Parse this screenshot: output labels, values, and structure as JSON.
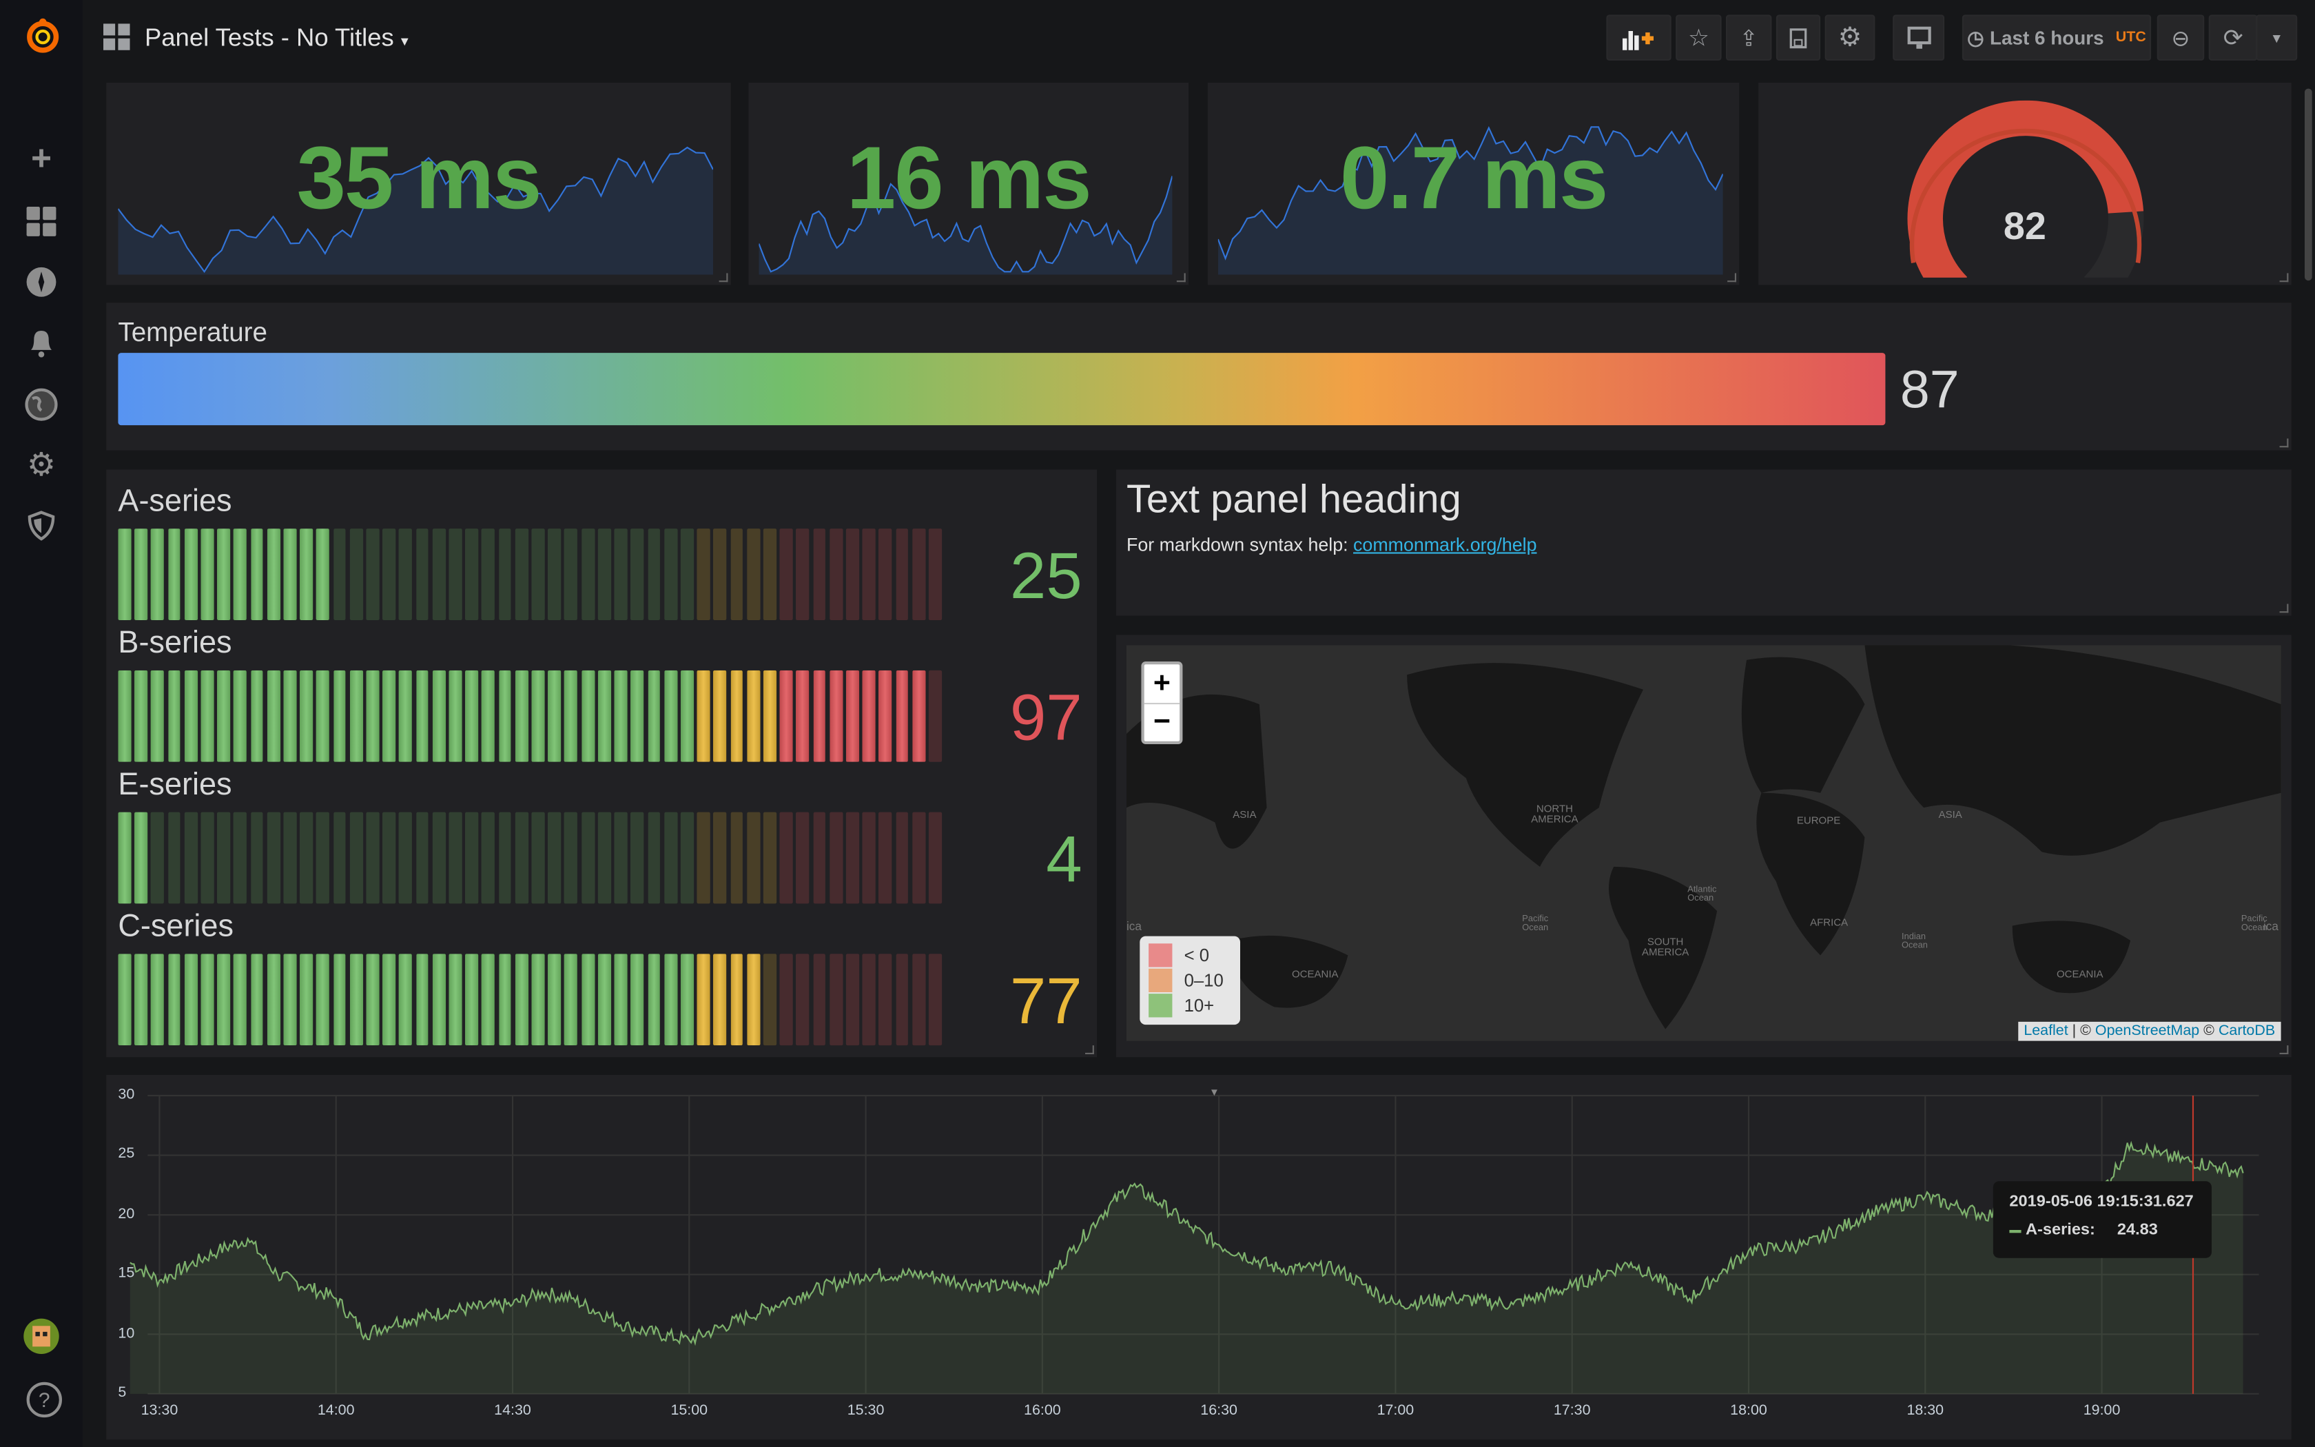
{
  "header": {
    "title": "Panel Tests - No Titles",
    "time_range": "Last 6 hours",
    "timezone": "UTC"
  },
  "icons": {
    "sidebar": [
      "grafana-logo-icon",
      "plus-icon",
      "dashboards-icon",
      "explore-compass-icon",
      "alerting-bell-icon",
      "globe-icon",
      "gear-icon",
      "shield-icon",
      "avatar",
      "help-icon"
    ],
    "toolbar": [
      "add-panel-icon",
      "star-icon",
      "share-icon",
      "save-icon",
      "settings-gear-icon",
      "tv-mode-icon",
      "clock-icon",
      "zoom-out-icon",
      "refresh-icon",
      "caret-down-icon"
    ]
  },
  "sidebar": {
    "help": "?"
  },
  "stats": [
    {
      "value": "35 ms"
    },
    {
      "value": "16 ms"
    },
    {
      "value": "0.7 ms"
    }
  ],
  "gauge": {
    "value": "82",
    "fraction": 0.82,
    "color": "#d44a3a"
  },
  "temperature": {
    "label": "Temperature",
    "value": "87",
    "color": "#e0555a"
  },
  "bar_gauges": [
    {
      "label": "A-series",
      "value": "25",
      "pct": 25,
      "color": "#73bf69"
    },
    {
      "label": "B-series",
      "value": "97",
      "pct": 97,
      "color": "#e0555a"
    },
    {
      "label": "E-series",
      "value": "4",
      "pct": 4,
      "color": "#73bf69"
    },
    {
      "label": "C-series",
      "value": "77",
      "pct": 77,
      "color": "#eab839"
    }
  ],
  "thresholds": {
    "green": "#73bf69",
    "yellow": "#eab839",
    "red": "#e0555a"
  },
  "text_panel": {
    "heading": "Text panel heading",
    "help_prefix": "For markdown syntax help: ",
    "link": "commonmark.org/help"
  },
  "map": {
    "zoom_in": "+",
    "zoom_out": "−",
    "legend": [
      {
        "label": "< 0",
        "color": "#e88a8a"
      },
      {
        "label": "0–10",
        "color": "#e8a87c"
      },
      {
        "label": "10+",
        "color": "#8ec27a"
      }
    ],
    "labels": [
      "Asia",
      "North America",
      "Europe",
      "Asia",
      "Africa",
      "South America",
      "Oceania",
      "Oceania",
      "Pacific Ocean",
      "Atlantic Ocean",
      "Indian Ocean",
      "Pacific Ocean",
      "ica",
      "ica"
    ],
    "attribution": {
      "leaflet": "Leaflet",
      "sep": " | © ",
      "osm": "OpenStreetMap",
      "sep2": " © ",
      "carto": "CartoDB"
    }
  },
  "chart_data": {
    "type": "area",
    "ylim": [
      5,
      30
    ],
    "yticks": [
      "30",
      "25",
      "20",
      "15",
      "10",
      "5"
    ],
    "xticks": [
      "13:30",
      "14:00",
      "14:30",
      "15:00",
      "15:30",
      "16:00",
      "16:30",
      "17:00",
      "17:30",
      "18:00",
      "18:30",
      "19:00"
    ],
    "grid": true,
    "series": [
      {
        "name": "A-series",
        "color": "#7eb26d",
        "x": [
          "13:25",
          "13:30",
          "13:40",
          "13:45",
          "13:50",
          "14:00",
          "14:05",
          "14:10",
          "14:20",
          "14:30",
          "14:35",
          "14:40",
          "14:50",
          "15:00",
          "15:10",
          "15:20",
          "15:30",
          "15:40",
          "15:50",
          "16:00",
          "16:05",
          "16:10",
          "16:15",
          "16:20",
          "16:25",
          "16:30",
          "16:40",
          "16:50",
          "17:00",
          "17:10",
          "17:20",
          "17:30",
          "17:40",
          "17:50",
          "17:55",
          "18:00",
          "18:10",
          "18:20",
          "18:30",
          "18:40",
          "18:50",
          "19:00",
          "19:05",
          "19:10",
          "19:20",
          "19:24"
        ],
        "values": [
          16,
          14.5,
          17,
          18,
          15,
          13,
          10,
          11,
          12,
          12.5,
          13.5,
          13,
          10.5,
          9.5,
          11.5,
          13.5,
          15,
          15,
          14,
          14,
          17,
          20,
          22.5,
          21,
          19,
          17.5,
          15.5,
          15.5,
          12.5,
          13,
          12.5,
          14,
          16,
          13,
          15,
          17,
          17.5,
          20,
          21.5,
          20,
          20.5,
          22,
          26,
          25,
          24,
          23.5
        ]
      }
    ],
    "tooltip": {
      "time": "2019-05-06 19:15:31.627",
      "series": "A-series:",
      "value": "24.83"
    }
  }
}
